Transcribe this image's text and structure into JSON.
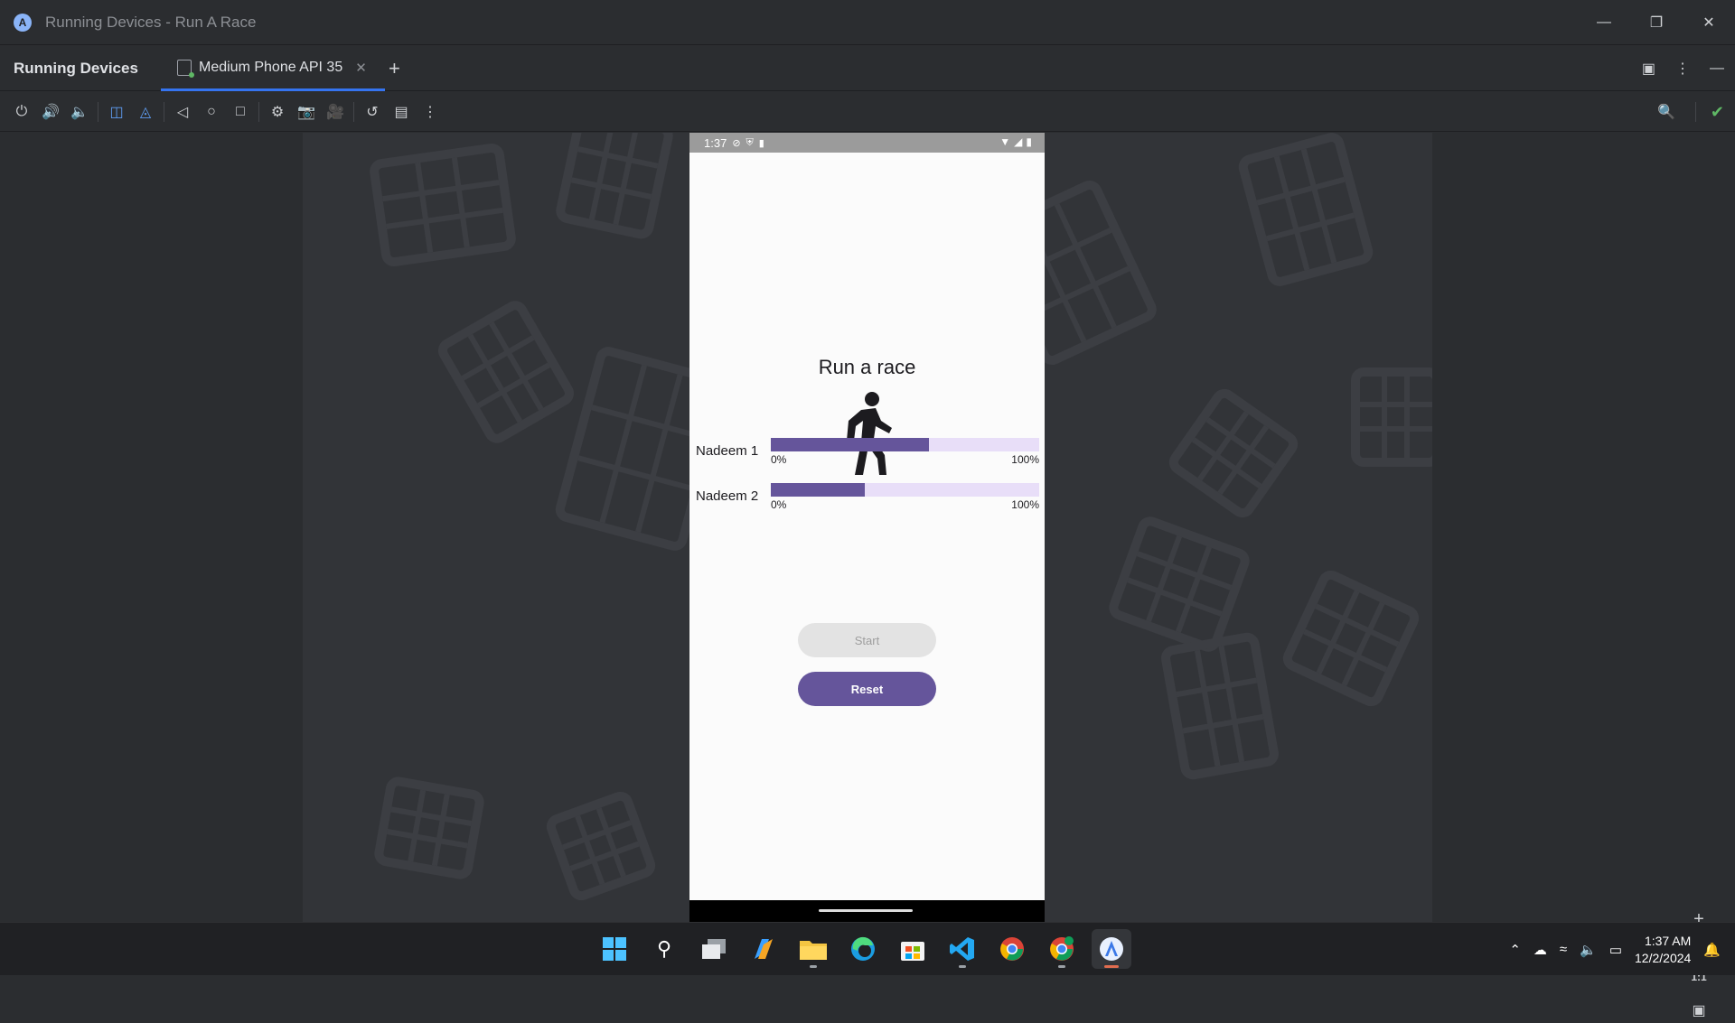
{
  "window": {
    "title": "Running Devices - Run A Race",
    "controls": [
      "minimize-icon",
      "restore-icon",
      "close-icon"
    ]
  },
  "panel": {
    "title": "Running Devices",
    "tab_label": "Medium Phone API 35"
  },
  "toolbar": {
    "icons": [
      "power-icon",
      "volume-up-icon",
      "volume-down-icon",
      "rotate-left-icon",
      "rotate-right-icon",
      "back-icon",
      "home-icon",
      "overview-icon",
      "device-settings-icon",
      "screenshot-icon",
      "screen-record-icon",
      "reset-icon",
      "mirror-icon",
      "more-icon"
    ]
  },
  "device": {
    "status_time": "1:37",
    "app": {
      "title": "Run a race",
      "racers": [
        {
          "name": "Nadeem 1",
          "progress": 0.59,
          "min_label": "0%",
          "max_label": "100%"
        },
        {
          "name": "Nadeem 2",
          "progress": 0.35,
          "min_label": "0%",
          "max_label": "100%"
        }
      ],
      "start_label": "Start",
      "reset_label": "Reset"
    }
  },
  "zoom": {
    "one_to_one": "1:1"
  },
  "taskbar": {
    "time": "1:37 AM",
    "date": "12/2/2024"
  },
  "colors": {
    "accent": "#3574f0",
    "progress_fill": "#65559b",
    "progress_track": "#e8def8"
  }
}
